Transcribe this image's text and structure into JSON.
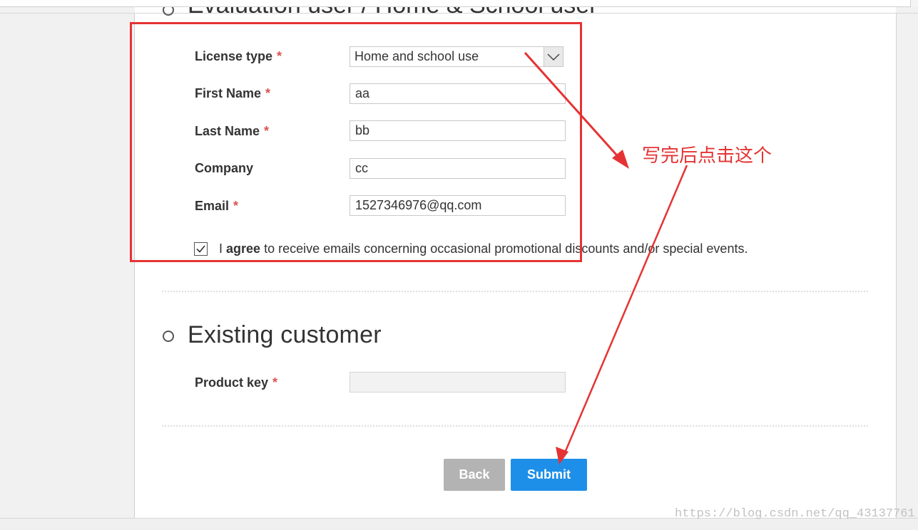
{
  "sections": {
    "evaluation_title": "Evaluation user / Home & School user",
    "existing_title": "Existing customer"
  },
  "form": {
    "license_type": {
      "label": "License type",
      "required": "*",
      "value": "Home and school use"
    },
    "first_name": {
      "label": "First Name",
      "required": "*",
      "value": "aa"
    },
    "last_name": {
      "label": "Last Name",
      "required": "*",
      "value": "bb"
    },
    "company": {
      "label": "Company",
      "value": "cc"
    },
    "email": {
      "label": "Email",
      "required": "*",
      "value": "1527346976@qq.com"
    },
    "agree": {
      "checked": true,
      "prefix": "I",
      "bold": "agree",
      "rest": "to receive emails concerning occasional promotional discounts and/or special events."
    },
    "product_key": {
      "label": "Product key",
      "required": "*",
      "value": ""
    }
  },
  "buttons": {
    "back": "Back",
    "submit": "Submit"
  },
  "annotation": {
    "text": "写完后点击这个",
    "color": "#e53333"
  },
  "watermark": "https://blog.csdn.net/qq_43137761",
  "colors": {
    "submit": "#1e8fe8",
    "back": "#b3b3b3",
    "required": "#d9534f"
  },
  "icons": {
    "select_arrow": "chevron-down-icon",
    "checkbox": "check-icon",
    "radio": "radio-icon"
  }
}
